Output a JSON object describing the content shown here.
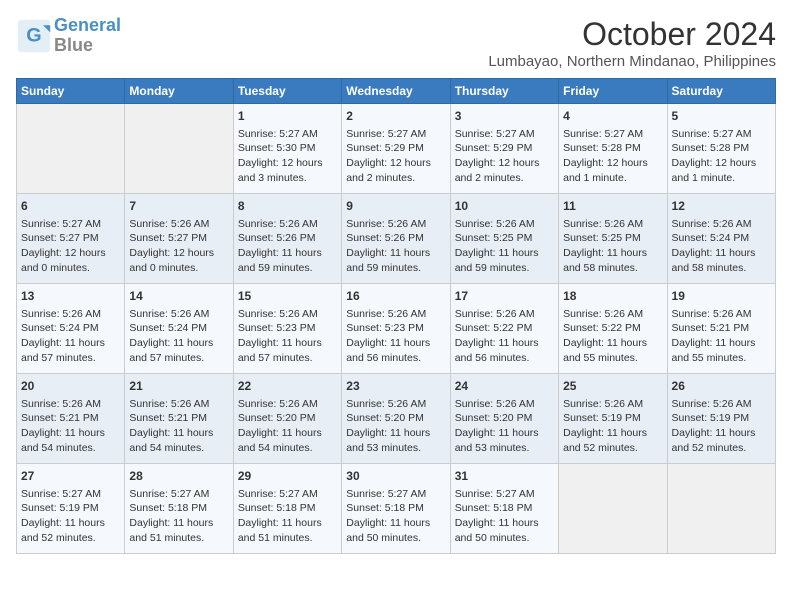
{
  "header": {
    "logo_line1": "General",
    "logo_line2": "Blue",
    "month": "October 2024",
    "location": "Lumbayao, Northern Mindanao, Philippines"
  },
  "columns": [
    "Sunday",
    "Monday",
    "Tuesday",
    "Wednesday",
    "Thursday",
    "Friday",
    "Saturday"
  ],
  "weeks": [
    [
      {
        "day": "",
        "content": ""
      },
      {
        "day": "",
        "content": ""
      },
      {
        "day": "1",
        "content": "Sunrise: 5:27 AM\nSunset: 5:30 PM\nDaylight: 12 hours\nand 3 minutes."
      },
      {
        "day": "2",
        "content": "Sunrise: 5:27 AM\nSunset: 5:29 PM\nDaylight: 12 hours\nand 2 minutes."
      },
      {
        "day": "3",
        "content": "Sunrise: 5:27 AM\nSunset: 5:29 PM\nDaylight: 12 hours\nand 2 minutes."
      },
      {
        "day": "4",
        "content": "Sunrise: 5:27 AM\nSunset: 5:28 PM\nDaylight: 12 hours\nand 1 minute."
      },
      {
        "day": "5",
        "content": "Sunrise: 5:27 AM\nSunset: 5:28 PM\nDaylight: 12 hours\nand 1 minute."
      }
    ],
    [
      {
        "day": "6",
        "content": "Sunrise: 5:27 AM\nSunset: 5:27 PM\nDaylight: 12 hours\nand 0 minutes."
      },
      {
        "day": "7",
        "content": "Sunrise: 5:26 AM\nSunset: 5:27 PM\nDaylight: 12 hours\nand 0 minutes."
      },
      {
        "day": "8",
        "content": "Sunrise: 5:26 AM\nSunset: 5:26 PM\nDaylight: 11 hours\nand 59 minutes."
      },
      {
        "day": "9",
        "content": "Sunrise: 5:26 AM\nSunset: 5:26 PM\nDaylight: 11 hours\nand 59 minutes."
      },
      {
        "day": "10",
        "content": "Sunrise: 5:26 AM\nSunset: 5:25 PM\nDaylight: 11 hours\nand 59 minutes."
      },
      {
        "day": "11",
        "content": "Sunrise: 5:26 AM\nSunset: 5:25 PM\nDaylight: 11 hours\nand 58 minutes."
      },
      {
        "day": "12",
        "content": "Sunrise: 5:26 AM\nSunset: 5:24 PM\nDaylight: 11 hours\nand 58 minutes."
      }
    ],
    [
      {
        "day": "13",
        "content": "Sunrise: 5:26 AM\nSunset: 5:24 PM\nDaylight: 11 hours\nand 57 minutes."
      },
      {
        "day": "14",
        "content": "Sunrise: 5:26 AM\nSunset: 5:24 PM\nDaylight: 11 hours\nand 57 minutes."
      },
      {
        "day": "15",
        "content": "Sunrise: 5:26 AM\nSunset: 5:23 PM\nDaylight: 11 hours\nand 57 minutes."
      },
      {
        "day": "16",
        "content": "Sunrise: 5:26 AM\nSunset: 5:23 PM\nDaylight: 11 hours\nand 56 minutes."
      },
      {
        "day": "17",
        "content": "Sunrise: 5:26 AM\nSunset: 5:22 PM\nDaylight: 11 hours\nand 56 minutes."
      },
      {
        "day": "18",
        "content": "Sunrise: 5:26 AM\nSunset: 5:22 PM\nDaylight: 11 hours\nand 55 minutes."
      },
      {
        "day": "19",
        "content": "Sunrise: 5:26 AM\nSunset: 5:21 PM\nDaylight: 11 hours\nand 55 minutes."
      }
    ],
    [
      {
        "day": "20",
        "content": "Sunrise: 5:26 AM\nSunset: 5:21 PM\nDaylight: 11 hours\nand 54 minutes."
      },
      {
        "day": "21",
        "content": "Sunrise: 5:26 AM\nSunset: 5:21 PM\nDaylight: 11 hours\nand 54 minutes."
      },
      {
        "day": "22",
        "content": "Sunrise: 5:26 AM\nSunset: 5:20 PM\nDaylight: 11 hours\nand 54 minutes."
      },
      {
        "day": "23",
        "content": "Sunrise: 5:26 AM\nSunset: 5:20 PM\nDaylight: 11 hours\nand 53 minutes."
      },
      {
        "day": "24",
        "content": "Sunrise: 5:26 AM\nSunset: 5:20 PM\nDaylight: 11 hours\nand 53 minutes."
      },
      {
        "day": "25",
        "content": "Sunrise: 5:26 AM\nSunset: 5:19 PM\nDaylight: 11 hours\nand 52 minutes."
      },
      {
        "day": "26",
        "content": "Sunrise: 5:26 AM\nSunset: 5:19 PM\nDaylight: 11 hours\nand 52 minutes."
      }
    ],
    [
      {
        "day": "27",
        "content": "Sunrise: 5:27 AM\nSunset: 5:19 PM\nDaylight: 11 hours\nand 52 minutes."
      },
      {
        "day": "28",
        "content": "Sunrise: 5:27 AM\nSunset: 5:18 PM\nDaylight: 11 hours\nand 51 minutes."
      },
      {
        "day": "29",
        "content": "Sunrise: 5:27 AM\nSunset: 5:18 PM\nDaylight: 11 hours\nand 51 minutes."
      },
      {
        "day": "30",
        "content": "Sunrise: 5:27 AM\nSunset: 5:18 PM\nDaylight: 11 hours\nand 50 minutes."
      },
      {
        "day": "31",
        "content": "Sunrise: 5:27 AM\nSunset: 5:18 PM\nDaylight: 11 hours\nand 50 minutes."
      },
      {
        "day": "",
        "content": ""
      },
      {
        "day": "",
        "content": ""
      }
    ]
  ]
}
